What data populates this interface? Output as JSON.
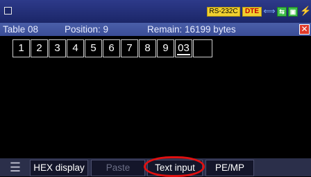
{
  "status": {
    "interface": "RS-232C",
    "mode": "DTE",
    "usb_icon": "usb-icon",
    "indicator1_icon": "green-port-icon",
    "indicator2_icon": "green-card-icon",
    "power_icon": "lightning-icon",
    "colors": {
      "badge": "#f0d030",
      "mode_text": "#c00000",
      "ok": "#3fbf4a",
      "close": "#e03a2a",
      "highlight": "#e01010"
    }
  },
  "info": {
    "table": "Table 08",
    "position": "Position: 9",
    "remain": "Remain: 16199 bytes",
    "close_glyph": "✕"
  },
  "cells": [
    "1",
    "2",
    "3",
    "4",
    "5",
    "6",
    "7",
    "8",
    "9",
    "03",
    ""
  ],
  "toolbar": {
    "menu_glyph": "☰",
    "hex": "HEX display",
    "paste": "Paste",
    "text_input": "Text input",
    "pe_mp": "PE/MP"
  }
}
